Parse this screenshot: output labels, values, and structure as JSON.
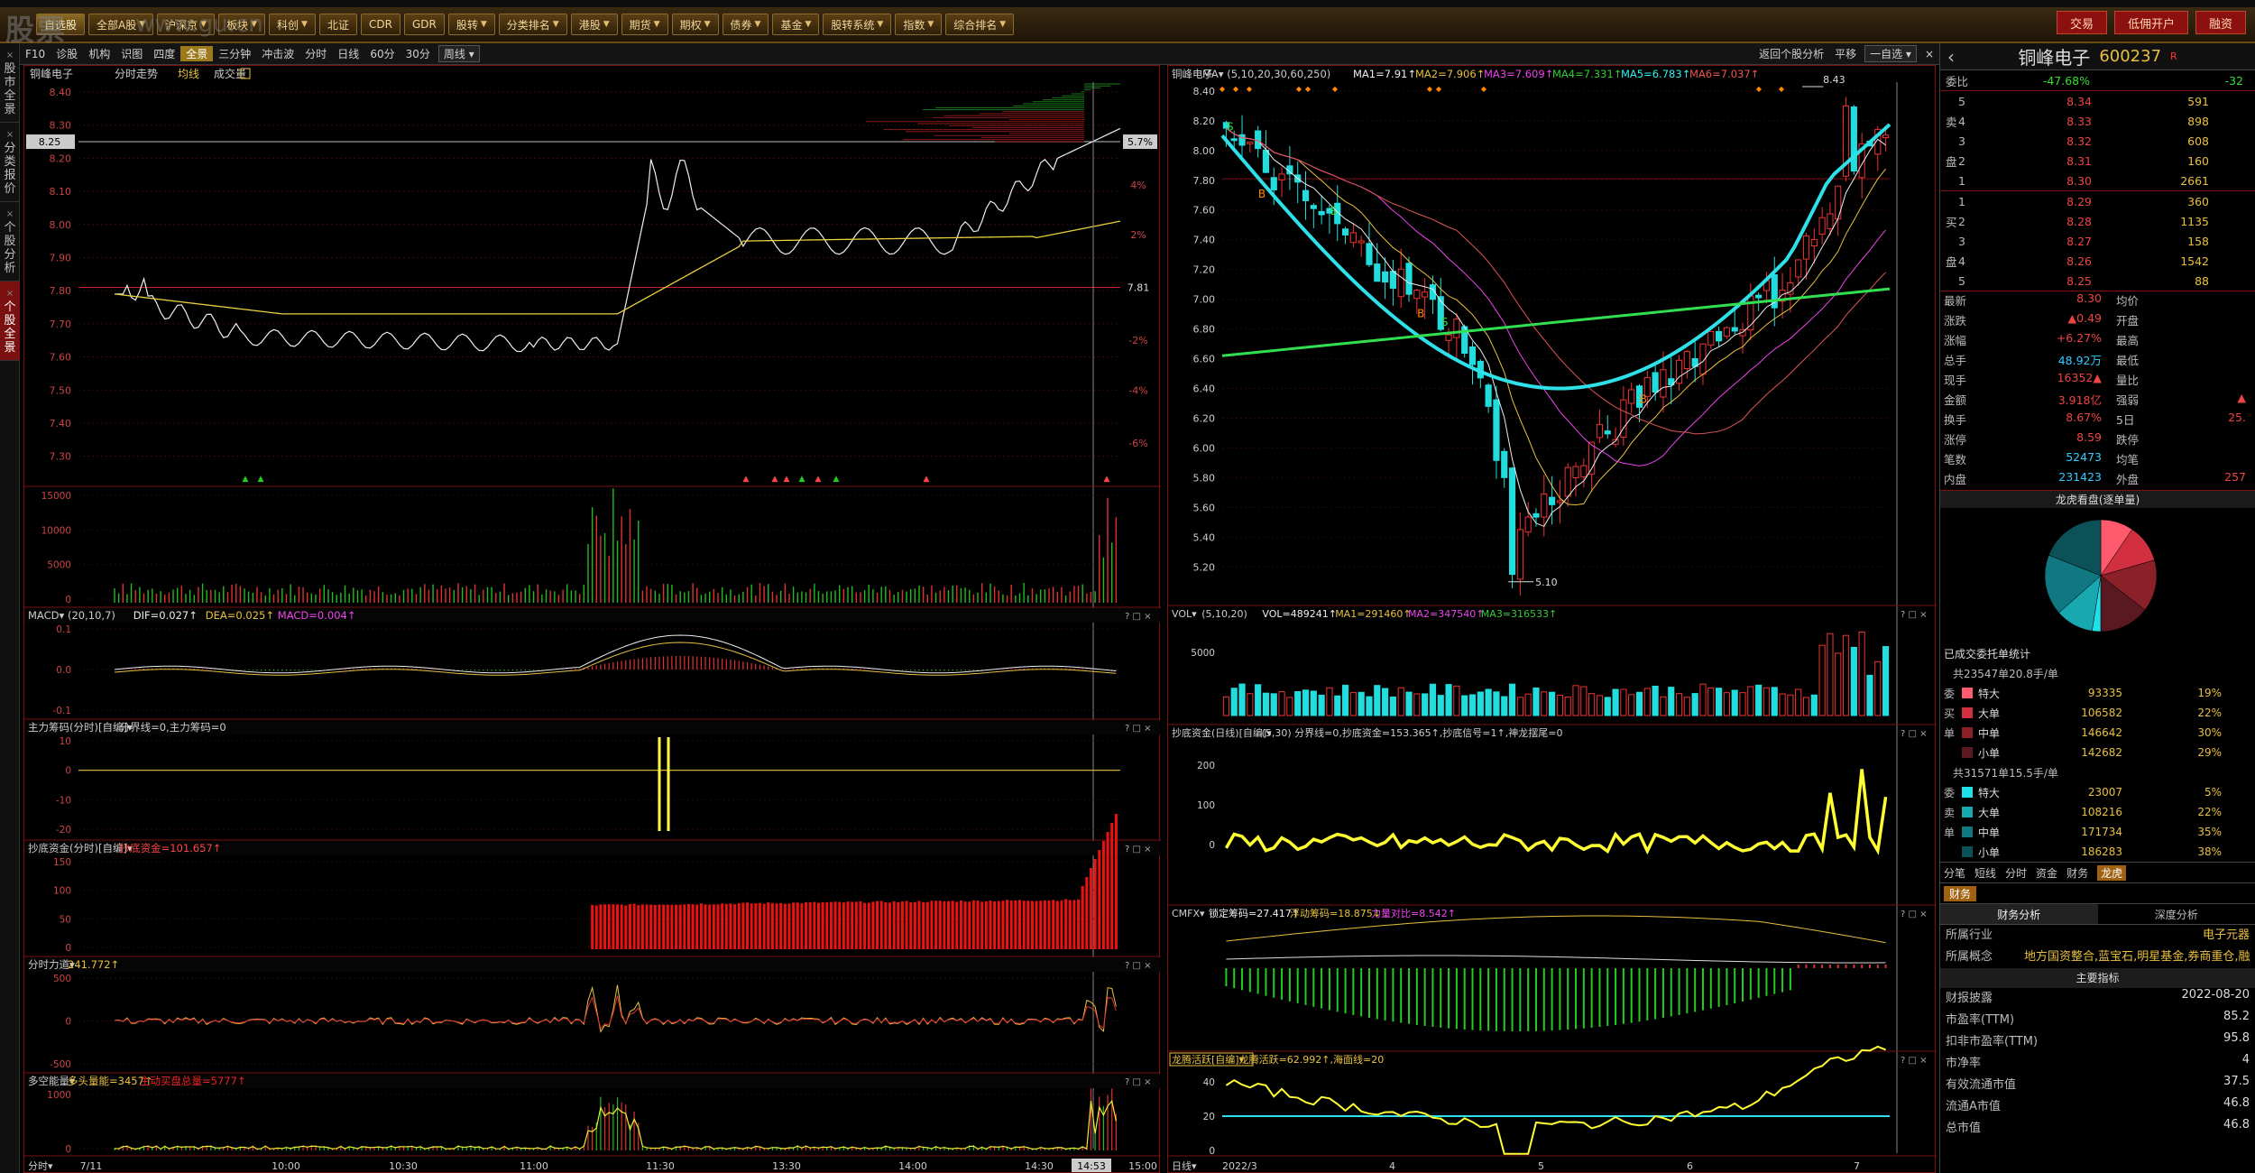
{
  "topbar": {
    "watermark": "股票",
    "watermark2": "www.gu.cn",
    "tabs": [
      {
        "label": "自选股",
        "dd": false,
        "active": true
      },
      {
        "label": "全部A股",
        "dd": true
      },
      {
        "label": "沪深京",
        "dd": true
      },
      {
        "label": "板块",
        "dd": true
      },
      {
        "label": "科创",
        "dd": true
      },
      {
        "label": "北证",
        "dd": false
      },
      {
        "label": "CDR",
        "dd": false
      },
      {
        "label": "GDR",
        "dd": false
      },
      {
        "label": "股转",
        "dd": true
      },
      {
        "label": "分类排名",
        "dd": true
      },
      {
        "label": "港股",
        "dd": true
      },
      {
        "label": "期货",
        "dd": true
      },
      {
        "label": "期权",
        "dd": true
      },
      {
        "label": "债券",
        "dd": true
      },
      {
        "label": "基金",
        "dd": true
      },
      {
        "label": "股转系统",
        "dd": true
      },
      {
        "label": "指数",
        "dd": true
      },
      {
        "label": "综合排名",
        "dd": true
      }
    ],
    "right_buttons": [
      "交易",
      "低佣开户",
      "融资"
    ]
  },
  "left_tabs": [
    {
      "label": "股市全景",
      "active": false
    },
    {
      "label": "分类报价",
      "active": false
    },
    {
      "label": "个股分析",
      "active": false
    },
    {
      "label": "个股全景",
      "active": true
    }
  ],
  "toolbar2": {
    "items": [
      "F10",
      "诊股",
      "机构",
      "识图",
      "四度",
      "全景",
      "三分钟",
      "冲击波",
      "分时",
      "日线",
      "60分",
      "30分",
      "周线"
    ],
    "active": "全景",
    "right": [
      "返回个股分析",
      "平移",
      "一自选"
    ]
  },
  "intraday": {
    "title": "铜峰电子",
    "sub1": "分时走势",
    "sub2": "均线",
    "sub3": "成交量",
    "y_left": [
      "8.40",
      "8.30",
      "8.25",
      "8.20",
      "8.10",
      "8.00",
      "7.90",
      "7.80",
      "7.70",
      "7.60",
      "7.50",
      "7.40",
      "7.30"
    ],
    "y_right": [
      "5.7%",
      "4%",
      "2%",
      "7.81",
      "-2%",
      "-4%",
      "-6%"
    ],
    "price_label": "8.25",
    "vol_ticks": [
      "15000",
      "10000",
      "5000",
      "0"
    ],
    "x_labels": [
      "7/11",
      "10:00",
      "10:30",
      "11:00",
      "11:30",
      "13:30",
      "14:00",
      "14:30",
      "14:53",
      "15:00"
    ],
    "bottom_left": "分时"
  },
  "macd": {
    "name": "MACD",
    "params": "(20,10,7)",
    "dif": "DIF=0.027↑",
    "dea": "DEA=0.025↑",
    "macd": "MACD=0.004↑",
    "ticks": [
      "0.1",
      "0.0",
      "-0.1"
    ]
  },
  "zljm": {
    "name": "主力筹码(分时)[自编]",
    "text": "分界线=0,主力筹码=0",
    "ticks": [
      "10",
      "0",
      "-10",
      "-20"
    ]
  },
  "cdzj": {
    "name": "抄底资金(分时)[自编]",
    "text": "抄底资金=101.657↑",
    "ticks": [
      "150",
      "100",
      "50",
      "0"
    ]
  },
  "fsld": {
    "name": "分时力道",
    "text": "241.772↑",
    "ticks": [
      "500",
      "0",
      "-500"
    ]
  },
  "dknl": {
    "name": "多空能量",
    "t1": "多头量能=3457↑",
    "t2": "主动买盘总量=5777↑",
    "ticks": [
      "1000",
      "0"
    ]
  },
  "kline": {
    "title": "铜峰电子",
    "ma_text": "MA▾ (5,10,20,30,60,250)",
    "ma1": "MA1=7.91↑",
    "ma2": "MA2=7.906↑",
    "ma3": "MA3=7.609↑",
    "ma4": "MA4=7.331↑",
    "ma5": "MA5=6.783↑",
    "ma6": "MA6=7.037↑",
    "y_ticks": [
      "8.40",
      "8.20",
      "8.00",
      "7.80",
      "7.60",
      "7.40",
      "7.20",
      "7.00",
      "6.80",
      "6.60",
      "6.40",
      "6.20",
      "6.00",
      "5.80",
      "5.60",
      "5.40",
      "5.20"
    ],
    "high_label": "8.43",
    "low_label": "5.10",
    "x_labels": [
      "2022/3",
      "4",
      "5",
      "6",
      "7"
    ],
    "bottom_left": "日线"
  },
  "vol": {
    "name": "VOL",
    "params": "(5,10,20)",
    "v": "VOL=489241↑",
    "ma1": "MA1=291460↑",
    "ma2": "MA2=347540↑",
    "ma3": "MA3=316533↑",
    "ticks": [
      "5000"
    ]
  },
  "cdzj_d": {
    "name": "抄底资金(日线)[自编]",
    "text": "(5,30) 分界线=0,抄底资金=153.365↑,抄底信号=1↑,神龙摆尾=0",
    "ticks": [
      "200",
      "100",
      "0"
    ]
  },
  "cmfx": {
    "name": "CMFX",
    "t1": "锁定筹码=27.417↑",
    "t2": "浮动筹码=18.875↓",
    "t3": "力量对比=8.542↑"
  },
  "lthy": {
    "name": "龙腾活跃[自编]",
    "text": "龙腾活跃=62.992↑,海面线=20",
    "ticks": [
      "40",
      "20",
      "0"
    ]
  },
  "right_panel": {
    "name": "铜峰电子",
    "code": "600237",
    "r_mark": "R",
    "weibi_label": "委比",
    "weibi": "-47.68%",
    "weicha": "-32",
    "sells": [
      {
        "lvl": "5",
        "price": "8.34",
        "vol": "591"
      },
      {
        "lvl": "4",
        "price": "8.33",
        "vol": "898"
      },
      {
        "lvl": "3",
        "price": "8.32",
        "vol": "608"
      },
      {
        "lvl": "2",
        "price": "8.31",
        "vol": "160"
      },
      {
        "lvl": "1",
        "price": "8.30",
        "vol": "2661"
      }
    ],
    "buys": [
      {
        "lvl": "1",
        "price": "8.29",
        "vol": "360"
      },
      {
        "lvl": "2",
        "price": "8.28",
        "vol": "1135"
      },
      {
        "lvl": "3",
        "price": "8.27",
        "vol": "158"
      },
      {
        "lvl": "4",
        "price": "8.26",
        "vol": "1542"
      },
      {
        "lvl": "5",
        "price": "8.25",
        "vol": "88"
      }
    ],
    "side_sell": [
      "",
      "卖",
      "",
      "盘",
      ""
    ],
    "side_buy": [
      "",
      "买",
      "",
      "盘",
      ""
    ],
    "stats": [
      {
        "k": "最新",
        "v": "8.30",
        "k2": "均价",
        "v2": ""
      },
      {
        "k": "涨跌",
        "v": "▲0.49",
        "k2": "开盘",
        "v2": ""
      },
      {
        "k": "涨幅",
        "v": "+6.27%",
        "k2": "最高",
        "v2": ""
      },
      {
        "k": "总手",
        "v": "48.92万",
        "k2": "最低",
        "v2": ""
      },
      {
        "k": "现手",
        "v": "16352▲",
        "k2": "量比",
        "v2": ""
      },
      {
        "k": "金额",
        "v": "3.918亿",
        "k2": "强弱",
        "v2": "▲"
      },
      {
        "k": "换手",
        "v": "8.67%",
        "k2": "5日",
        "v2": "25."
      },
      {
        "k": "涨停",
        "v": "8.59",
        "k2": "跌停",
        "v2": ""
      },
      {
        "k": "笔数",
        "v": "52473",
        "k2": "均笔",
        "v2": ""
      },
      {
        "k": "内盘",
        "v": "231423",
        "k2": "外盘",
        "v2": "257"
      }
    ],
    "pie_title": "龙虎看盘(逐单量)",
    "stat_title": "已成交委托单统计",
    "group1": {
      "head": "共23547单20.8手/单",
      "rows": [
        {
          "side": "委",
          "name": "特大",
          "v": "93335",
          "p": "19%",
          "color": "#ff5a6e"
        },
        {
          "side": "买",
          "name": "大单",
          "v": "106582",
          "p": "22%",
          "color": "#d23040"
        },
        {
          "side": "单",
          "name": "中单",
          "v": "146642",
          "p": "30%",
          "color": "#8a2028"
        },
        {
          "side": "",
          "name": "小单",
          "v": "142682",
          "p": "29%",
          "color": "#5a1820"
        }
      ]
    },
    "group2": {
      "head": "共31571单15.5手/单",
      "rows": [
        {
          "side": "委",
          "name": "特大",
          "v": "23007",
          "p": "5%",
          "color": "#20e0e8"
        },
        {
          "side": "卖",
          "name": "大单",
          "v": "108216",
          "p": "22%",
          "color": "#18a8b0"
        },
        {
          "side": "单",
          "name": "中单",
          "v": "171734",
          "p": "35%",
          "color": "#107880"
        },
        {
          "side": "",
          "name": "小单",
          "v": "186283",
          "p": "38%",
          "color": "#0c5058"
        }
      ]
    },
    "btabs": [
      "分笔",
      "短线",
      "分时",
      "资金",
      "财务",
      "龙虎"
    ],
    "btab_active": "龙虎",
    "fin_tab": "财务",
    "fin_sub": [
      "财务分析",
      "深度分析"
    ],
    "fin_rows": [
      {
        "k": "所属行业",
        "v": "电子元器"
      },
      {
        "k": "所属概念",
        "v": "地方国资整合,蓝宝石,明星基金,券商重仓,融资融"
      }
    ],
    "main_title": "主要指标",
    "indicators": [
      {
        "k": "财报披露",
        "v": "2022-08-20"
      },
      {
        "k": "市盈率(TTM)",
        "v": "85.2"
      },
      {
        "k": "扣非市盈率(TTM)",
        "v": "95.8"
      },
      {
        "k": "市净率",
        "v": "4"
      },
      {
        "k": "有效流通市值",
        "v": "37.5"
      },
      {
        "k": "流通A市值",
        "v": "46.8"
      },
      {
        "k": "总市值",
        "v": "46.8"
      }
    ]
  }
}
